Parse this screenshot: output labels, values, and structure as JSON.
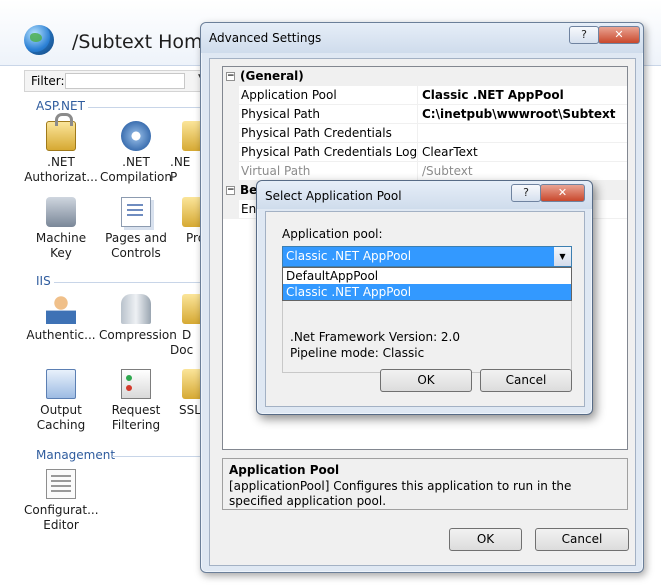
{
  "iis": {
    "site_title": "/Subtext Home",
    "filter_label": "Filter:",
    "groups": {
      "aspnet": "ASP.NET",
      "iis": "IIS",
      "management": "Management"
    },
    "features": [
      {
        "label": ".NET Authorizat...",
        "icon": "lock-icon"
      },
      {
        "label": ".NET Compilation",
        "icon": "gear-icon"
      },
      {
        "label": ".NE P",
        "icon": "partial-icon"
      },
      {
        "label": "Machine Key",
        "icon": "key-icon"
      },
      {
        "label": "Pages and Controls",
        "icon": "page-icon"
      },
      {
        "label": "Pro",
        "icon": "partial-icon"
      },
      {
        "label": "Authentic...",
        "icon": "user-icon"
      },
      {
        "label": "Compression",
        "icon": "clamp-icon"
      },
      {
        "label": "D Doc",
        "icon": "partial-icon"
      },
      {
        "label": "Output Caching",
        "icon": "cache-icon"
      },
      {
        "label": "Request Filtering",
        "icon": "filter-icon"
      },
      {
        "label": "SSL",
        "icon": "partial-icon"
      },
      {
        "label": "Configurat... Editor",
        "icon": "config-icon"
      }
    ]
  },
  "advanced_settings": {
    "title": "Advanced Settings",
    "help_label": "?",
    "close_label": "✕",
    "category_general": "(General)",
    "category_behavior": "Be",
    "rows": [
      {
        "name": "Application Pool",
        "value": "Classic .NET AppPool"
      },
      {
        "name": "Physical Path",
        "value": "C:\\inetpub\\wwwroot\\Subtext"
      },
      {
        "name": "Physical Path Credentials",
        "value": ""
      },
      {
        "name": "Physical Path Credentials Logon Type",
        "value": "ClearText"
      },
      {
        "name": "Virtual Path",
        "value": "/Subtext"
      }
    ],
    "behavior_row_name": "Ena",
    "description_title": "Application Pool",
    "description_text": "[applicationPool] Configures this application to run in the specified application pool.",
    "ok_label": "OK",
    "cancel_label": "Cancel"
  },
  "select_pool": {
    "title": "Select Application Pool",
    "help_label": "?",
    "close_label": "✕",
    "pool_label": "Application pool:",
    "selected_value": "Classic .NET AppPool",
    "options": [
      "DefaultAppPool",
      "Classic .NET AppPool"
    ],
    "framework_line": ".Net Framework Version: 2.0",
    "pipeline_line": "Pipeline mode: Classic",
    "ok_label": "OK",
    "cancel_label": "Cancel"
  }
}
